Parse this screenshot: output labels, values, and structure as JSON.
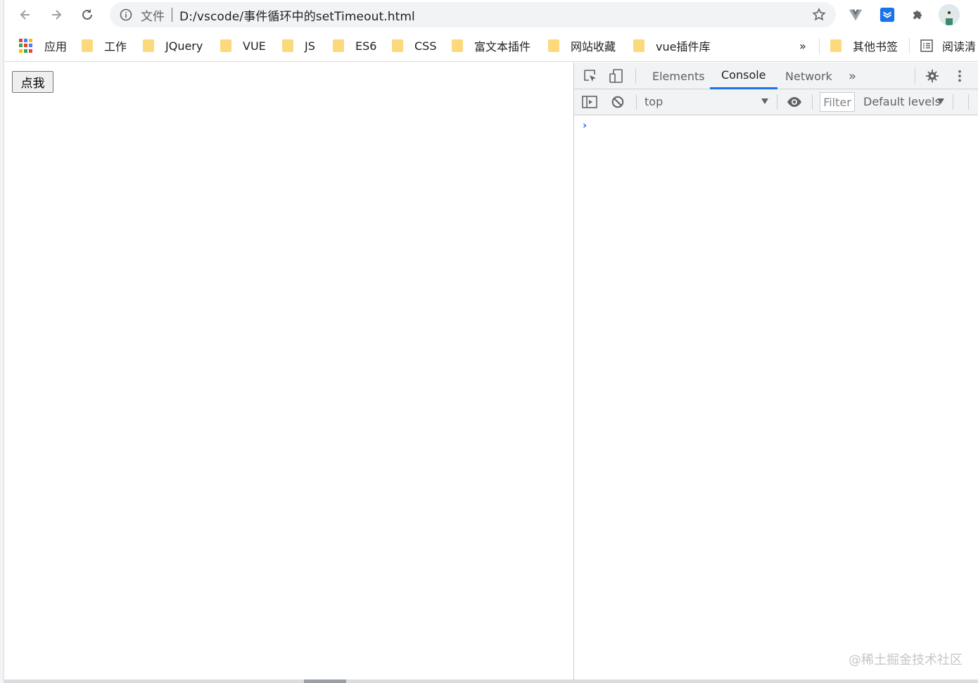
{
  "browser": {
    "url_origin_label": "文件",
    "url": "D:/vscode/事件循环中的setTimeout.html",
    "icons": [
      "back-icon",
      "forward-icon",
      "reload-icon",
      "info-icon",
      "star-icon",
      "vue-devtools-icon",
      "extension-icon",
      "puzzle-icon",
      "avatar"
    ]
  },
  "bookmarks": {
    "apps_label": "应用",
    "items": [
      {
        "label": "工作"
      },
      {
        "label": "JQuery"
      },
      {
        "label": "VUE"
      },
      {
        "label": "JS"
      },
      {
        "label": "ES6"
      },
      {
        "label": "CSS"
      },
      {
        "label": "富文本插件"
      },
      {
        "label": "网站收藏"
      },
      {
        "label": "vue插件库"
      }
    ],
    "overflow_label": "»",
    "other_label": "其他书签",
    "reading_label": "阅读清"
  },
  "page": {
    "button_label": "点我"
  },
  "devtools": {
    "tabs": [
      {
        "label": "Elements"
      },
      {
        "label": "Console"
      },
      {
        "label": "Network"
      }
    ],
    "more_tabs_label": "»",
    "context_label": "top",
    "filter_placeholder": "Filter",
    "levels_label": "Default levels",
    "prompt_symbol": "›",
    "accent_color": "#1a73e8"
  },
  "watermark": "@稀土掘金技术社区"
}
